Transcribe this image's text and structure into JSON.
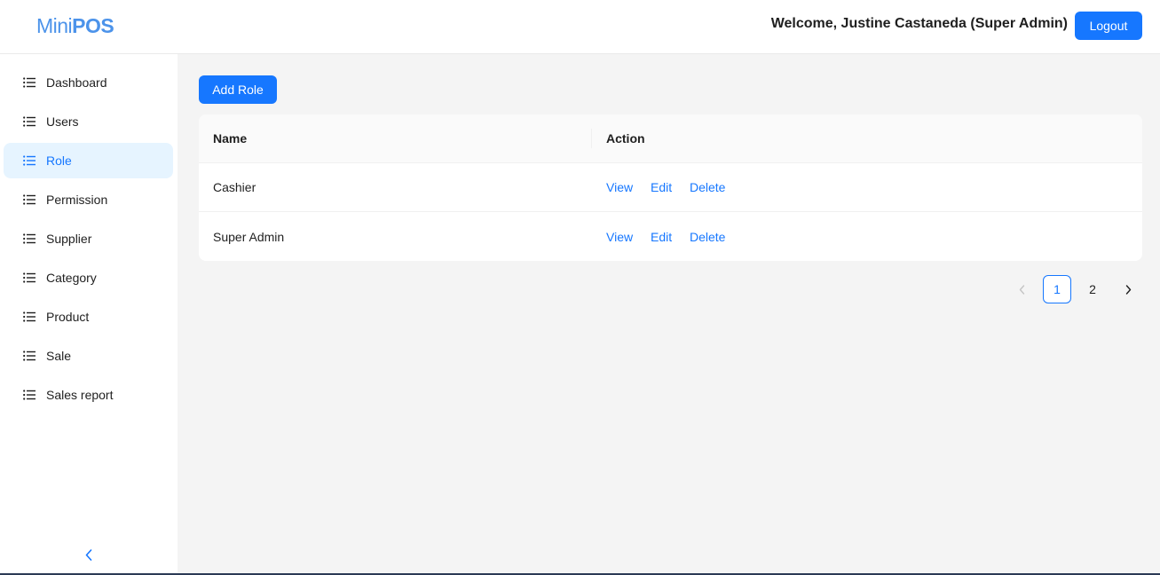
{
  "header": {
    "logo_light": "Mini",
    "logo_bold": "POS",
    "welcome": "Welcome, Justine Castaneda (Super Admin)",
    "logout_label": "Logout"
  },
  "sidebar": {
    "items": [
      {
        "label": "Dashboard",
        "active": false
      },
      {
        "label": "Users",
        "active": false
      },
      {
        "label": "Role",
        "active": true
      },
      {
        "label": "Permission",
        "active": false
      },
      {
        "label": "Supplier",
        "active": false
      },
      {
        "label": "Category",
        "active": false
      },
      {
        "label": "Product",
        "active": false
      },
      {
        "label": "Sale",
        "active": false
      },
      {
        "label": "Sales report",
        "active": false
      }
    ],
    "collapse_icon": "chevron-left-icon"
  },
  "main": {
    "add_role_label": "Add Role",
    "table": {
      "columns": [
        "Name",
        "Action"
      ],
      "rows": [
        {
          "name": "Cashier",
          "actions": [
            "View",
            "Edit",
            "Delete"
          ]
        },
        {
          "name": "Super Admin",
          "actions": [
            "View",
            "Edit",
            "Delete"
          ]
        }
      ]
    },
    "pagination": {
      "pages": [
        "1",
        "2"
      ],
      "current": "1"
    }
  },
  "colors": {
    "primary": "#1677ff",
    "logo": "#4c93ea",
    "active_bg": "#e6f4ff",
    "page_bg": "#f4f4f4"
  }
}
